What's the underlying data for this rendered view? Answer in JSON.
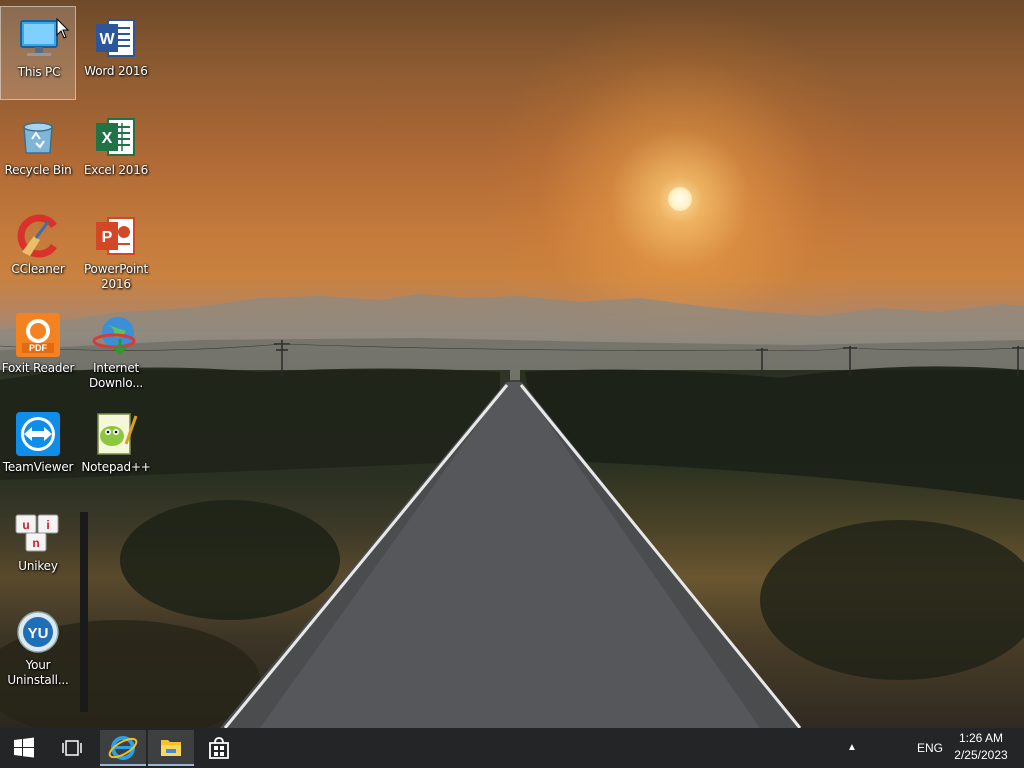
{
  "desktop": {
    "icons": [
      {
        "label": "This PC",
        "icon": "this-pc-icon",
        "selected": true
      },
      {
        "label": "Word 2016",
        "icon": "word-icon"
      },
      {
        "label": "Recycle Bin",
        "icon": "recycle-bin-icon"
      },
      {
        "label": "Excel 2016",
        "icon": "excel-icon"
      },
      {
        "label": "CCleaner",
        "icon": "ccleaner-icon"
      },
      {
        "label": "PowerPoint 2016",
        "icon": "powerpoint-icon"
      },
      {
        "label": "Foxit Reader",
        "icon": "foxit-reader-icon"
      },
      {
        "label": "Internet Downlo...",
        "icon": "internet-download-manager-icon"
      },
      {
        "label": "TeamViewer",
        "icon": "teamviewer-icon"
      },
      {
        "label": "Notepad++",
        "icon": "notepadpp-icon"
      },
      {
        "label": "Unikey",
        "icon": "unikey-icon"
      },
      {
        "label": "Your Uninstall...",
        "icon": "your-uninstaller-icon"
      }
    ],
    "wallpaper": "sunset-road"
  },
  "taskbar": {
    "start_icon": "windows-start-icon",
    "taskview_icon": "task-view-icon",
    "pinned": [
      {
        "icon": "internet-explorer-icon",
        "active": true
      },
      {
        "icon": "file-explorer-icon",
        "active": true
      },
      {
        "icon": "store-icon",
        "active": false
      }
    ],
    "tray_arrow": "▲",
    "language": "ENG",
    "time": "1:26 AM",
    "date": "2/25/2023"
  },
  "colors": {
    "taskbar_bg": "#101214",
    "word_blue": "#2b579a",
    "excel_green": "#217346",
    "powerpoint_red": "#d24726",
    "foxit_orange": "#f58220",
    "teamviewer_blue": "#0e8ee9"
  }
}
